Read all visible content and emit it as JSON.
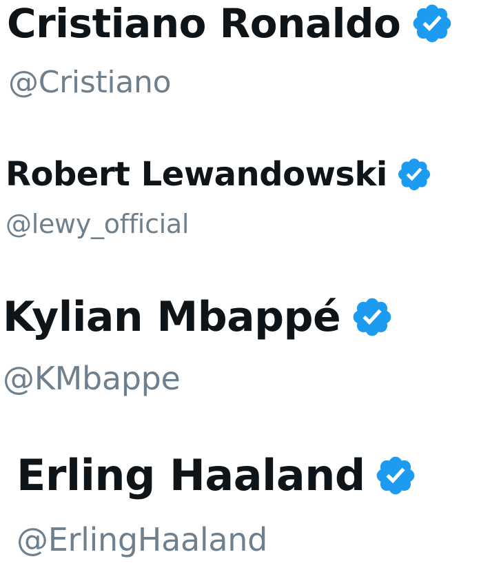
{
  "accent_color": "#1d9bf0",
  "name_color": "#0f1419",
  "handle_color": "#6e7f8e",
  "badge_icon": "verified-badge-icon",
  "profiles": [
    {
      "name": "Cristiano Ronaldo",
      "handle": "@Cristiano",
      "verified": true
    },
    {
      "name": "Robert Lewandowski",
      "handle": "@lewy_official",
      "verified": true
    },
    {
      "name": "Kylian Mbappé",
      "handle": "@KMbappe",
      "verified": true
    },
    {
      "name": "Erling Haaland",
      "handle": "@ErlingHaaland",
      "verified": true
    }
  ]
}
